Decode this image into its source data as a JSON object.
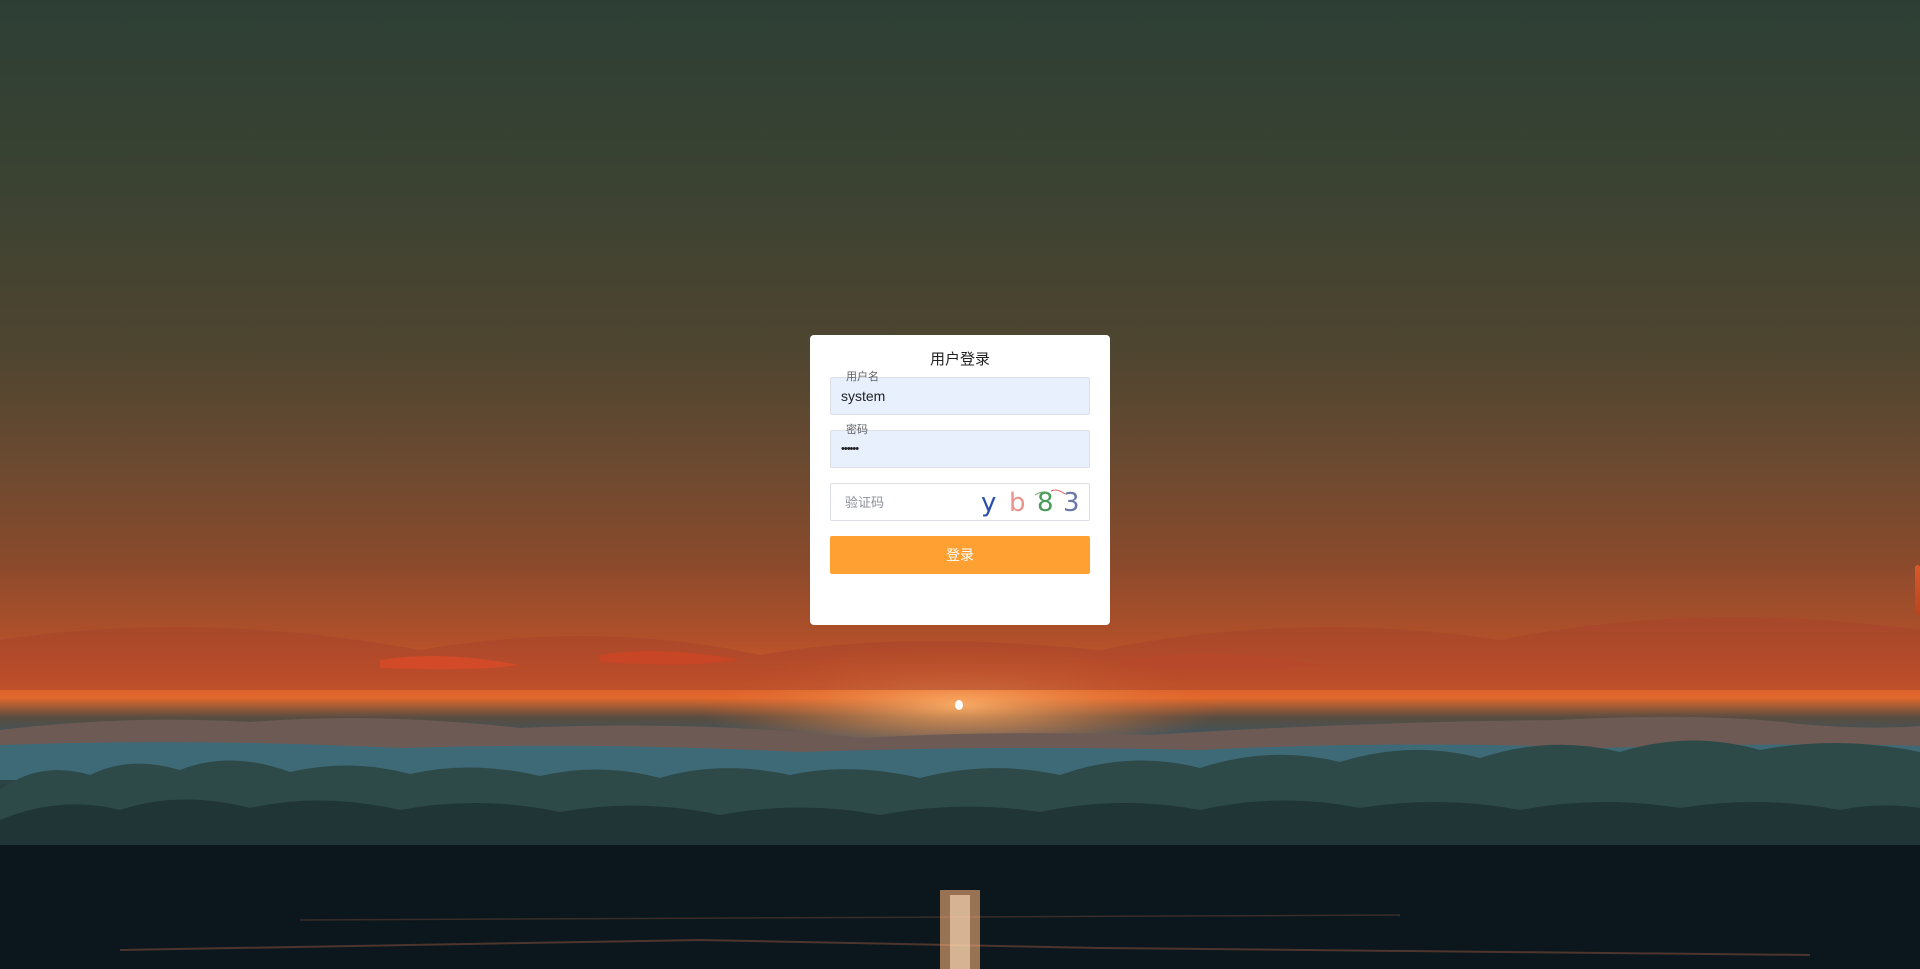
{
  "login": {
    "title": "用户登录",
    "username_label": "用户名",
    "username_value": "system",
    "password_label": "密码",
    "password_value": "••••••",
    "captcha_placeholder": "验证码",
    "captcha_chars": [
      {
        "char": "y",
        "color": "#2b4fa8"
      },
      {
        "char": "b",
        "color": "#e8948a"
      },
      {
        "char": "8",
        "color": "#4a9a5a"
      },
      {
        "char": "3",
        "color": "#6a78a8"
      }
    ],
    "submit_label": "登录"
  },
  "colors": {
    "accent": "#ffa033",
    "input_fill": "#e8f0fe"
  }
}
